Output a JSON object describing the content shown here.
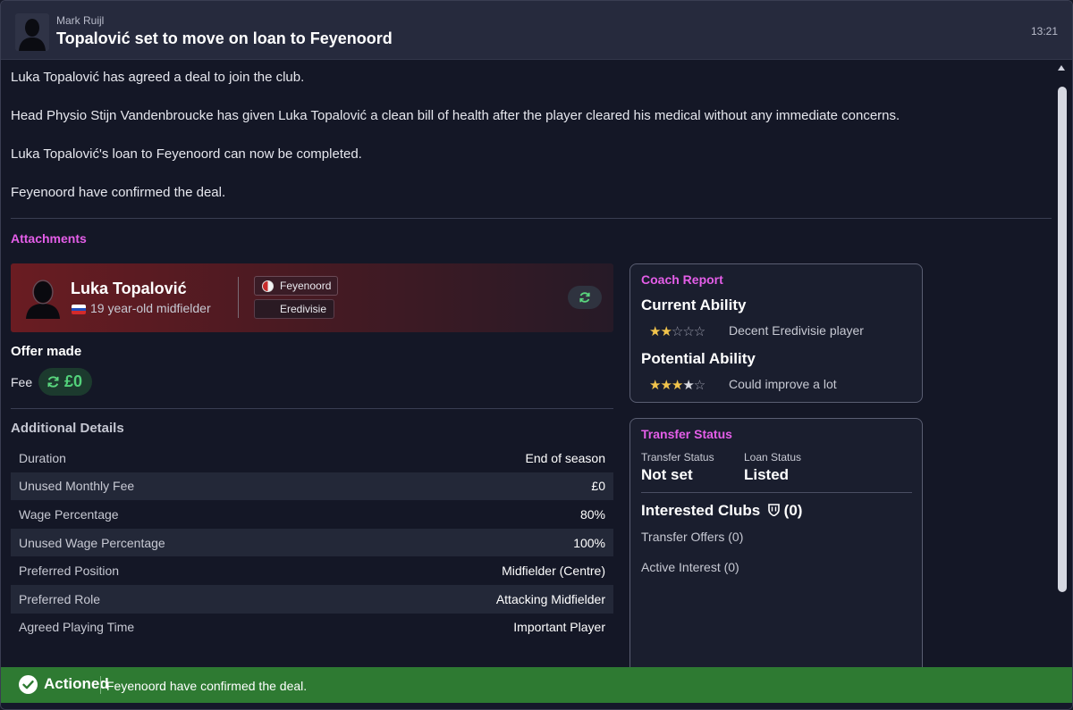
{
  "header": {
    "sender": "Mark Ruijl",
    "title": "Topalović set to move on loan to Feyenoord",
    "time": "13:21"
  },
  "message": {
    "paragraphs": [
      "Luka Topalović has agreed a deal to join the club.",
      "Head Physio Stijn Vandenbroucke has given Luka Topalović a clean bill of health after the player cleared his medical without any immediate concerns.",
      "Luka Topalović's loan to Feyenoord can now be completed.",
      "Feyenoord have confirmed the deal."
    ]
  },
  "attachments": {
    "title": "Attachments",
    "player": {
      "name": "Luka Topalović",
      "description": "19 year-old midfielder",
      "club": "Feyenoord",
      "league": "Eredivisie"
    },
    "offer": {
      "title": "Offer made",
      "fee_label": "Fee",
      "fee_value": "£0"
    },
    "additional": {
      "title": "Additional Details",
      "rows": [
        {
          "key": "Duration",
          "value": "End of season"
        },
        {
          "key": "Unused Monthly Fee",
          "value": "£0"
        },
        {
          "key": "Wage Percentage",
          "value": "80%"
        },
        {
          "key": "Unused Wage Percentage",
          "value": "100%"
        },
        {
          "key": "Preferred Position",
          "value": "Midfielder (Centre)"
        },
        {
          "key": "Preferred Role",
          "value": "Attacking Midfielder"
        },
        {
          "key": "Agreed Playing Time",
          "value": "Important Player"
        }
      ]
    }
  },
  "coach_report": {
    "title": "Coach Report",
    "current_ability": {
      "label": "Current Ability",
      "stars": 2,
      "max": 5,
      "description": "Decent Eredivisie player"
    },
    "potential_ability": {
      "label": "Potential Ability",
      "stars": 3.5,
      "max": 5,
      "description": "Could improve a lot"
    }
  },
  "transfer_status": {
    "title": "Transfer Status",
    "transfer_status_label": "Transfer Status",
    "transfer_status_value": "Not set",
    "loan_status_label": "Loan Status",
    "loan_status_value": "Listed",
    "interested_title": "Interested Clubs",
    "interested_count": "(0)",
    "transfer_offers": "Transfer Offers  (0)",
    "active_interest": "Active Interest  (0)"
  },
  "footer": {
    "status": "Actioned",
    "message": "Feyenoord have confirmed the deal."
  },
  "colors": {
    "accent_pink": "#e45ee8",
    "success_green": "#2e7a32",
    "star_gold": "#f2c44c"
  },
  "icons": [
    "person-silhouette-icon",
    "refresh-icon",
    "shield-icon",
    "check-icon",
    "scroll-up-icon"
  ]
}
